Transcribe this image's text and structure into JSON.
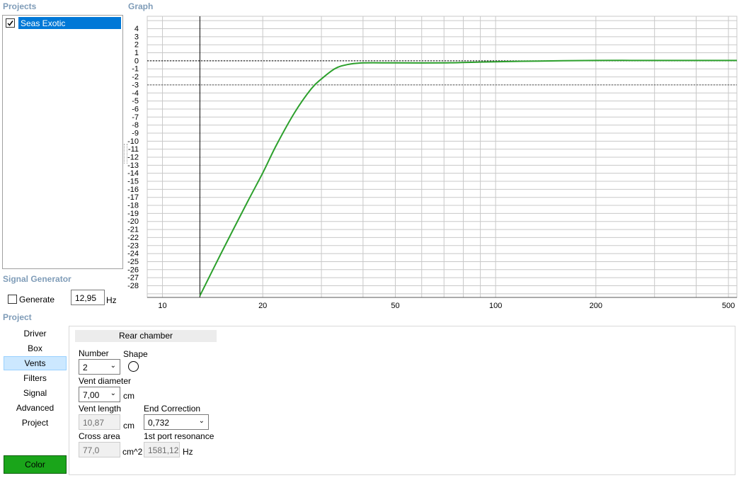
{
  "sections": {
    "projects": "Projects",
    "graph": "Graph",
    "signal_generator": "Signal Generator",
    "project": "Project"
  },
  "projects_list": [
    {
      "label": "Seas Exotic",
      "checked": true,
      "selected": true
    }
  ],
  "signal_generator": {
    "generate_label": "Generate",
    "generate_checked": false,
    "frequency_value": "12,95",
    "frequency_unit": "Hz"
  },
  "nav": {
    "items": [
      "Driver",
      "Box",
      "Vents",
      "Filters",
      "Signal",
      "Advanced",
      "Project"
    ],
    "selected": "Vents",
    "color_button": "Color",
    "color_button_bg": "#1aa51a"
  },
  "vents_panel": {
    "header": "Rear chamber",
    "number_label": "Number",
    "number_value": "2",
    "shape_label": "Shape",
    "shape_icon": "circle-icon",
    "vent_diameter_label": "Vent diameter",
    "vent_diameter_value": "7,00",
    "vent_diameter_unit": "cm",
    "vent_length_label": "Vent length",
    "vent_length_value": "10,87",
    "vent_length_unit": "cm",
    "end_correction_label": "End Correction",
    "end_correction_value": "0,732",
    "cross_area_label": "Cross area",
    "cross_area_value": "77,0",
    "cross_area_unit": "cm^2",
    "port_resonance_label": "1st port resonance",
    "port_resonance_value": "1581,12",
    "port_resonance_unit": "Hz"
  },
  "chart_data": {
    "type": "line",
    "x_scale": "log",
    "xlim": [
      9,
      530
    ],
    "ylim": [
      -29.5,
      5.5
    ],
    "x_ticks": [
      10,
      20,
      50,
      100,
      200,
      500
    ],
    "y_ticks": [
      4,
      3,
      2,
      1,
      0,
      -1,
      -2,
      -3,
      -4,
      -5,
      -6,
      -7,
      -8,
      -9,
      -10,
      -11,
      -12,
      -13,
      -14,
      -15,
      -16,
      -17,
      -18,
      -19,
      -20,
      -21,
      -22,
      -23,
      -24,
      -25,
      -26,
      -27,
      -28
    ],
    "grid": true,
    "reference_lines": [
      0,
      -3
    ],
    "marker_x": 12.95,
    "series": [
      {
        "color": "#2ca02c",
        "x": [
          12.95,
          15,
          18,
          20,
          22,
          25,
          28,
          30,
          33,
          36,
          40,
          50,
          70,
          90,
          120,
          200,
          300,
          530
        ],
        "y": [
          -29.3,
          -24.0,
          -17.6,
          -14.0,
          -10.5,
          -6.4,
          -3.5,
          -2.3,
          -1.0,
          -0.5,
          -0.3,
          -0.3,
          -0.3,
          -0.2,
          -0.1,
          0.0,
          0.0,
          0.0
        ]
      }
    ]
  }
}
